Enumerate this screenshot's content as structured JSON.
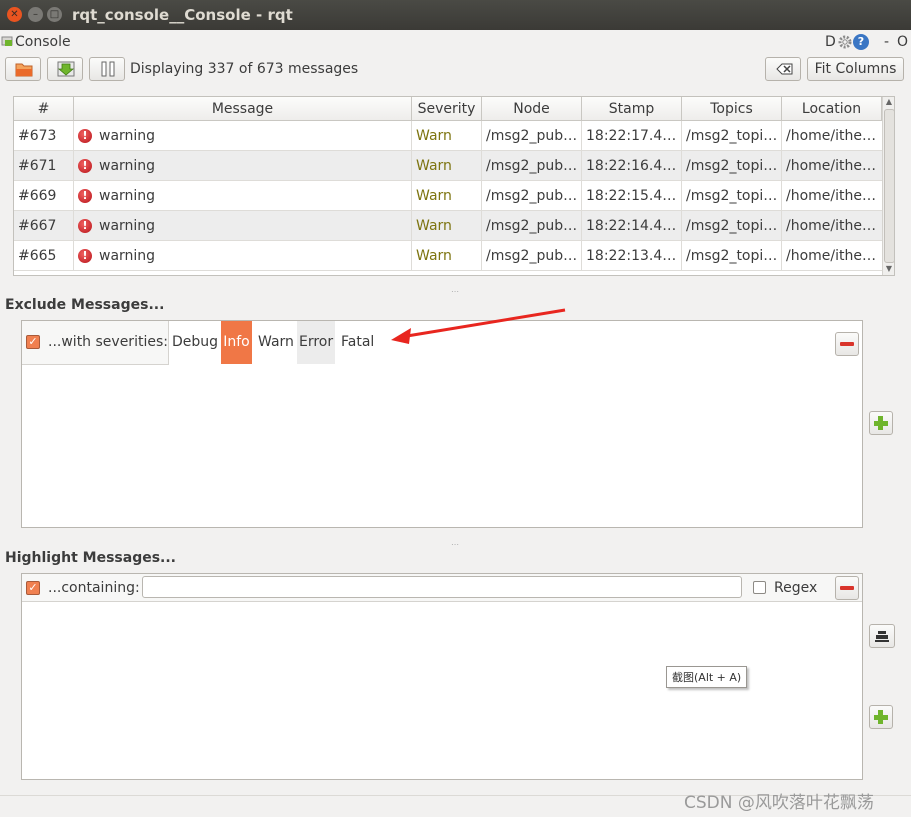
{
  "window": {
    "title": "rqt_console__Console - rqt"
  },
  "plugin": {
    "title": "Console",
    "right_labels": [
      "D",
      "-",
      "O"
    ]
  },
  "toolbar": {
    "status": "Displaying 337 of 673 messages",
    "fit_columns_label": "Fit Columns"
  },
  "table": {
    "headers": [
      "#",
      "Message",
      "Severity",
      "Node",
      "Stamp",
      "Topics",
      "Location"
    ],
    "rows": [
      {
        "id": "#673",
        "message": "warning",
        "severity": "Warn",
        "node": "/msg2_pub…",
        "stamp": "18:22:17.4…",
        "topics": "/msg2_topi…",
        "location": "/home/ithe…"
      },
      {
        "id": "#671",
        "message": "warning",
        "severity": "Warn",
        "node": "/msg2_pub…",
        "stamp": "18:22:16.4…",
        "topics": "/msg2_topi…",
        "location": "/home/ithe…"
      },
      {
        "id": "#669",
        "message": "warning",
        "severity": "Warn",
        "node": "/msg2_pub…",
        "stamp": "18:22:15.4…",
        "topics": "/msg2_topi…",
        "location": "/home/ithe…"
      },
      {
        "id": "#667",
        "message": "warning",
        "severity": "Warn",
        "node": "/msg2_pub…",
        "stamp": "18:22:14.4…",
        "topics": "/msg2_topi…",
        "location": "/home/ithe…"
      },
      {
        "id": "#665",
        "message": "warning",
        "severity": "Warn",
        "node": "/msg2_pub…",
        "stamp": "18:22:13.4…",
        "topics": "/msg2_topi…",
        "location": "/home/ithe…"
      }
    ]
  },
  "exclude": {
    "title": "Exclude Messages...",
    "filter_label": "...with severities:",
    "severities": [
      "Debug",
      "Info",
      "Warn",
      "Error",
      "Fatal"
    ],
    "selected": "Info"
  },
  "highlight": {
    "title": "Highlight Messages...",
    "filter_label": "...containing:",
    "input_value": "",
    "regex_label": "Regex"
  },
  "tooltip": {
    "text": "截图(Alt + A)"
  },
  "watermark": "CSDN @风吹落叶花飘荡",
  "colors": {
    "accent": "#f07746",
    "warn_text": "#7d7410",
    "arrow": "#e8261f"
  }
}
